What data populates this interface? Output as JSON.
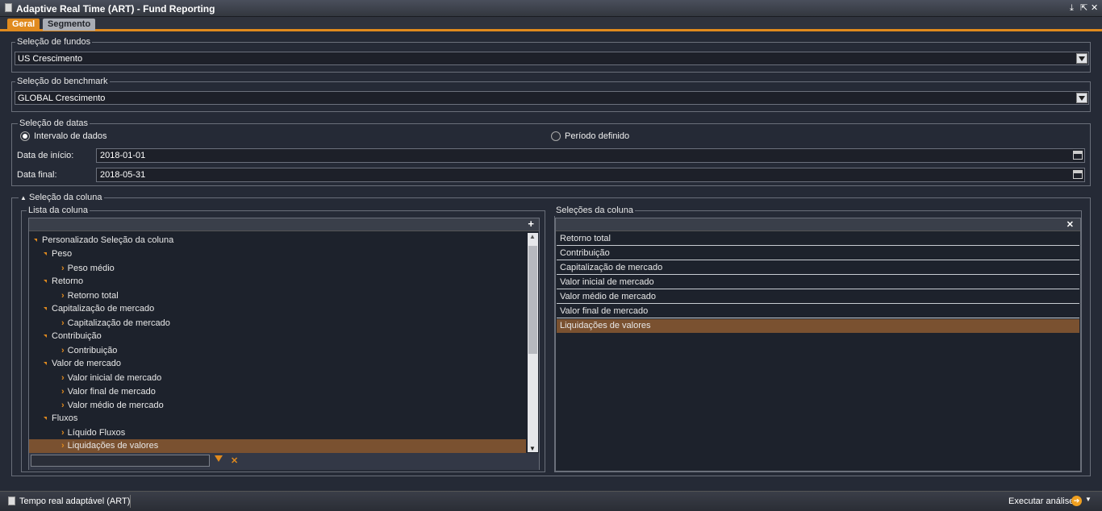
{
  "window": {
    "title": "Adaptive Real Time (ART) - Fund Reporting"
  },
  "tabs": [
    {
      "label": "Geral"
    },
    {
      "label": "Segmento"
    }
  ],
  "funds": {
    "legend": "Seleção de fundos",
    "value": "US Crescimento"
  },
  "benchmark": {
    "legend": "Seleção do benchmark",
    "value": "GLOBAL Crescimento"
  },
  "dates": {
    "legend": "Seleção de datas",
    "range_label": "Intervalo de dados",
    "period_label": "Período definido",
    "start_label": "Data de início:",
    "start_value": "2018-01-01",
    "end_label": "Data final:",
    "end_value": "2018-05-31"
  },
  "columns": {
    "legend": "Seleção da coluna",
    "list_legend": "Lista da coluna",
    "selected_legend": "Seleções da coluna",
    "tree": [
      {
        "label": "Personalizado Seleção da coluna",
        "level": 0,
        "type": "group"
      },
      {
        "label": "Peso",
        "level": 1,
        "type": "group"
      },
      {
        "label": "Peso médio",
        "level": 2,
        "type": "leaf"
      },
      {
        "label": "Retorno",
        "level": 1,
        "type": "group"
      },
      {
        "label": "Retorno total",
        "level": 2,
        "type": "leaf"
      },
      {
        "label": "Capitalização de mercado",
        "level": 1,
        "type": "group"
      },
      {
        "label": "Capitalização de mercado",
        "level": 2,
        "type": "leaf"
      },
      {
        "label": "Contribuição",
        "level": 1,
        "type": "group"
      },
      {
        "label": "Contribuição",
        "level": 2,
        "type": "leaf"
      },
      {
        "label": "Valor de mercado",
        "level": 1,
        "type": "group"
      },
      {
        "label": "Valor inicial de mercado",
        "level": 2,
        "type": "leaf"
      },
      {
        "label": "Valor final de mercado",
        "level": 2,
        "type": "leaf"
      },
      {
        "label": "Valor médio de mercado",
        "level": 2,
        "type": "leaf"
      },
      {
        "label": "Fluxos",
        "level": 1,
        "type": "group"
      },
      {
        "label": "Líquido Fluxos",
        "level": 2,
        "type": "leaf"
      },
      {
        "label": "Liquidações de valores",
        "level": 2,
        "type": "leaf",
        "selected": true
      }
    ],
    "selected": [
      {
        "label": "Retorno total"
      },
      {
        "label": "Contribuição"
      },
      {
        "label": "Capitalização de mercado"
      },
      {
        "label": "Valor inicial de mercado"
      },
      {
        "label": "Valor médio de mercado"
      },
      {
        "label": "Valor final de mercado"
      },
      {
        "label": "Liquidações de valores",
        "selected": true
      }
    ],
    "filter_value": ""
  },
  "status": {
    "left_label": "Tempo real adaptável (ART)",
    "run_label": "Executar análise"
  },
  "colors": {
    "accent": "#e08a1e",
    "selected_row": "#7a5130",
    "background": "#252a36"
  }
}
